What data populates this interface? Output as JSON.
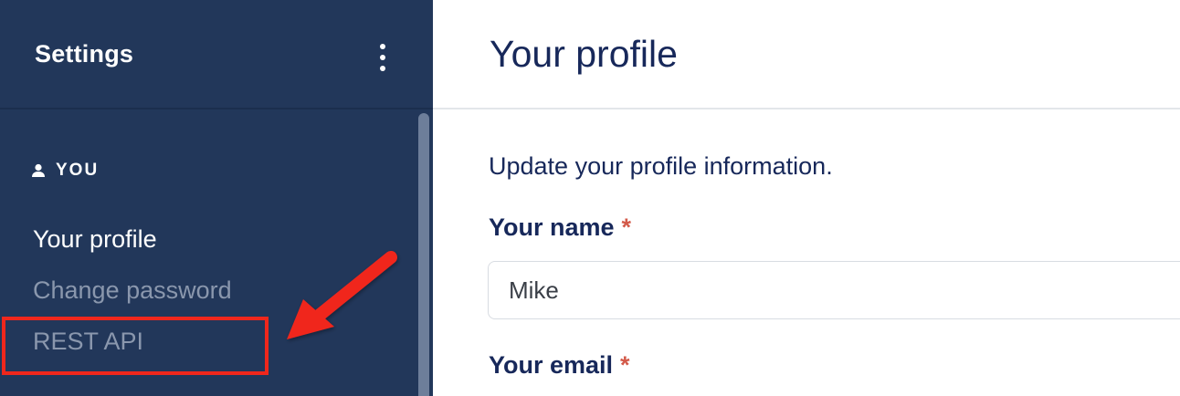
{
  "sidebar": {
    "title": "Settings",
    "menu_icon": "more-vertical-icon",
    "section": {
      "icon": "person-icon",
      "label": "YOU"
    },
    "items": [
      {
        "label": "Your profile",
        "state": "active"
      },
      {
        "label": "Change password",
        "state": "inactive"
      },
      {
        "label": "REST API",
        "state": "inactive"
      }
    ],
    "colors": {
      "background": "#22375a",
      "active_text": "#ffffff",
      "inactive_text": "#8a97ad"
    }
  },
  "annotation": {
    "color": "#f0271c",
    "target": "REST API"
  },
  "main": {
    "title": "Your profile",
    "intro": "Update your profile information.",
    "fields": [
      {
        "label": "Your name",
        "required_mark": "*",
        "value": "Mike"
      },
      {
        "label": "Your email",
        "required_mark": "*"
      }
    ],
    "colors": {
      "heading": "#17285a",
      "required": "#d35a4a"
    }
  }
}
